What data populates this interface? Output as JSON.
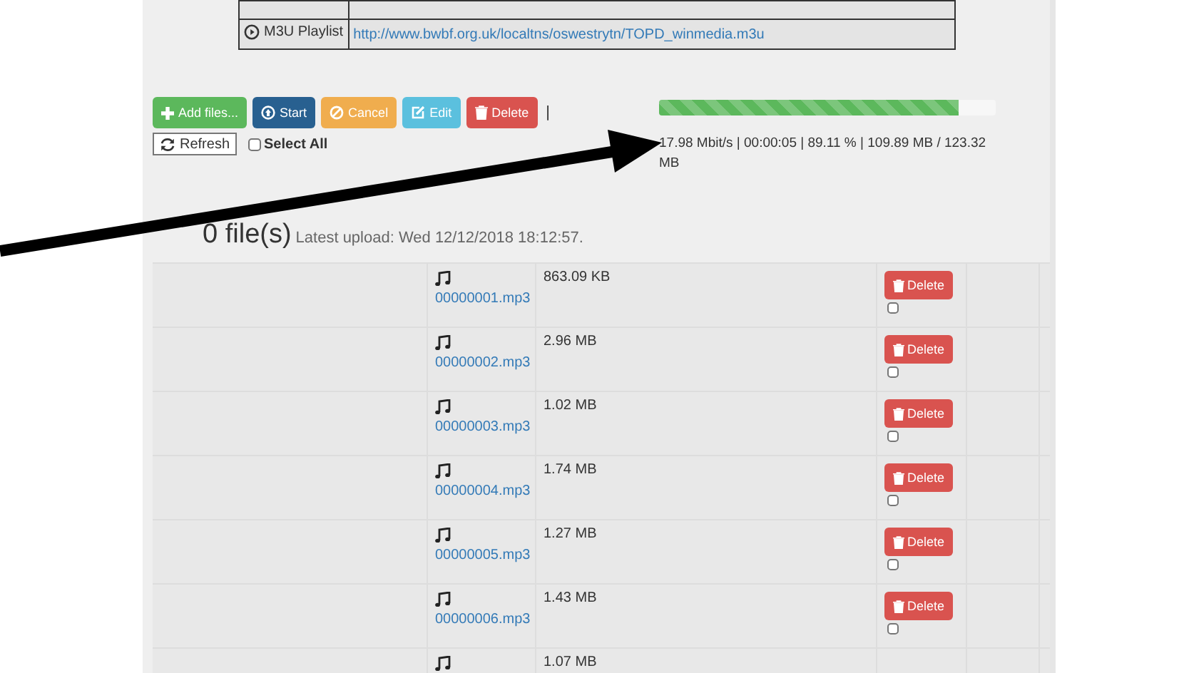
{
  "links_table": {
    "rows": [
      {
        "label": "M3U Playlist",
        "url": "http://www.bwbf.org.uk/localtns/oswestrytn/TOPD_winmedia.m3u"
      }
    ]
  },
  "toolbar": {
    "buttons": [
      {
        "kind": "add",
        "label": "Add files..."
      },
      {
        "kind": "start",
        "label": "Start"
      },
      {
        "kind": "cancel",
        "label": "Cancel"
      },
      {
        "kind": "edit",
        "label": "Edit"
      },
      {
        "kind": "delete",
        "label": "Delete"
      }
    ],
    "separator": "|",
    "refresh": "Refresh",
    "select_all": {
      "label": "Select All",
      "checked": false
    }
  },
  "progress": {
    "level": 0.89,
    "stats": "17.98 Mbit/s | 00:00:05 | 89.11 % | 109.89 MB / 123.32 MB"
  },
  "summary": {
    "count": "0 file(s)",
    "latest": "Latest upload: Wed 12/12/2018 18:12:57."
  },
  "files": [
    {
      "name": "00000001.mp3",
      "size": "863.09 KB",
      "delete": "Delete",
      "checked": false
    },
    {
      "name": "00000002.mp3",
      "size": "2.96 MB",
      "delete": "Delete",
      "checked": false
    },
    {
      "name": "00000003.mp3",
      "size": "1.02 MB",
      "delete": "Delete",
      "checked": false
    },
    {
      "name": "00000004.mp3",
      "size": "1.74 MB",
      "delete": "Delete",
      "checked": false
    },
    {
      "name": "00000005.mp3",
      "size": "1.27 MB",
      "delete": "Delete",
      "checked": false
    },
    {
      "name": "00000006.mp3",
      "size": "1.43 MB",
      "delete": "Delete",
      "checked": false
    },
    {
      "size": "1.07 MB"
    }
  ]
}
